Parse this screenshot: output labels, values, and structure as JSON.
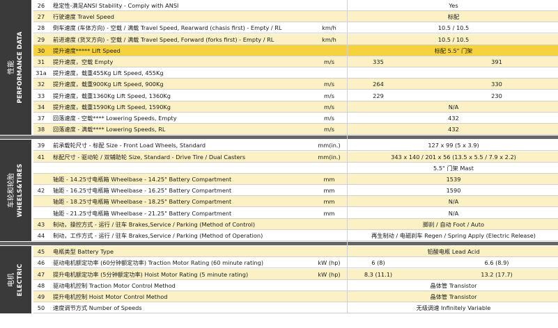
{
  "sections": {
    "performance": {
      "cn": "性能",
      "en": "PERFORMANCE DATA"
    },
    "wheels": {
      "cn": "车轮和轮胎",
      "en": "WHEELS&TIRES"
    },
    "electric": {
      "cn": "电机",
      "en": "ELECTRIC"
    }
  },
  "rows": [
    {
      "num": "26",
      "desc": "稳定性-满足ANSI    Stability - Comply with ANSI",
      "unit": "",
      "val": "Yes"
    },
    {
      "num": "27",
      "desc": "行驶速度    Travel Speed",
      "unit": "",
      "val": "标配"
    },
    {
      "num": "28",
      "desc": "倒车速度 (车体方向) - 空载 / 满载    Travel Speed, Rearward (chasis first) - Empty / RL",
      "unit": "km/h",
      "val": "10.5 / 10.5"
    },
    {
      "num": "29",
      "desc": "前进速度 (货叉方向) - 空载 / 满载    Travel Speed, Forward (forks first) - Empty / RL",
      "unit": "km/h",
      "val": "10.5 / 10.5"
    },
    {
      "num": "30",
      "desc": "提升速度*****    Lift Speed",
      "unit": "",
      "val": "标配   5.5\" 门架"
    },
    {
      "num": "31",
      "desc": "提升速度，空载    Empty",
      "unit": "m/s",
      "v1": "335",
      "v2": "391"
    },
    {
      "num": "31a",
      "desc": "提升速度，载重455Kg    Lift Speed, 455Kg",
      "unit": "",
      "val": ""
    },
    {
      "num": "32",
      "desc": "提升速度，载重900Kg    Lift Speed, 900Kg",
      "unit": "m/s",
      "v1": "264",
      "v2": "330"
    },
    {
      "num": "33",
      "desc": "提升速度，载重1360Kg    Lift Speed, 1360Kg",
      "unit": "m/s",
      "v1": "229",
      "v2": "230"
    },
    {
      "num": "34",
      "desc": "提升速度，载重1590Kg    Lift Speed, 1590Kg",
      "unit": "m/s",
      "val": "N/A"
    },
    {
      "num": "37",
      "desc": "回落速度 - 空载****    Lowering Speeds, Empty",
      "unit": "m/s",
      "val": "432"
    },
    {
      "num": "38",
      "desc": "回落速度 - 满载****    Lowering Speeds, RL",
      "unit": "m/s",
      "val": "432"
    },
    {
      "num": "39",
      "desc": "前承载轮尺寸 - 标配    Size - Front Load Wheels, Standard",
      "unit": "mm(in.)",
      "val": "127 x 99 (5 x 3.9)"
    },
    {
      "num": "41",
      "desc": "标配尺寸 - 驱动轮 / 双辅助轮    Size, Standard - Drive Tire / Dual Casters",
      "unit": "mm(in.)",
      "val": "343 x 140 / 201 x 56 (13.5 x 5.5 / 7.9 x 2.2)"
    },
    {
      "num": "",
      "desc": "",
      "unit": "",
      "val": "5.5\" 门架 Mast"
    },
    {
      "num": "",
      "desc": "轴距 - 14.25寸电瓶箱    Wheelbase - 14.25\" Battery Compartment",
      "unit": "mm",
      "val": "1539"
    },
    {
      "num": "",
      "desc": "轴距 - 16.25寸电瓶箱    Wheelbase - 16.25\" Battery Compartment",
      "unit": "mm",
      "val": "1590"
    },
    {
      "num": "",
      "desc": "轴距 - 18.25寸电瓶箱    Wheelbase - 18.25\" Battery Compartment",
      "unit": "mm",
      "val": "N/A"
    },
    {
      "num": "",
      "desc": "轴距 - 21.25寸电瓶箱    Wheelbase - 21.25\" Battery Compartment",
      "unit": "mm",
      "val": "N/A"
    },
    {
      "num": "43",
      "desc": "制动，操控方式 - 运行 / 驻车    Brakes,Service / Parking (Method of Control)",
      "unit": "",
      "val": "脚刹 / 自动 Foot / Auto"
    },
    {
      "num": "44",
      "desc": "制动，工作方式 - 运行 / 驻车    Brakes,Service / Parking (Method of Operation)",
      "unit": "",
      "val": "再生制动 / 电磁刹车 Regen / Spring Apply (Electric Release)"
    },
    {
      "num": "45",
      "desc": "电瓶类型    Battery Type",
      "unit": "",
      "val": "铅酸电瓶 Lead Acid"
    },
    {
      "num": "46",
      "desc": "驱动电机额定功率 (60分钟额定功率)    Traction Motor Rating (60 minute rating)",
      "unit": "kW (hp)",
      "v1": "6 (8)",
      "v2": "6.6 (8.9)"
    },
    {
      "num": "47",
      "desc": "提升电机额定功率 (5分钟额定功率)    Hoist Motor Rating (5 minute rating)",
      "unit": "kW (hp)",
      "v1": "8.3 (11.1)",
      "v2": "13.2 (17.7)"
    },
    {
      "num": "48",
      "desc": "驱动电机控制    Traction Motor Control Method",
      "unit": "",
      "val": "晶体管 Transistor"
    },
    {
      "num": "49",
      "desc": "提升电机控制    Hoist Motor Control Method",
      "unit": "",
      "val": "晶体管 Transistor"
    },
    {
      "num": "50",
      "desc": "速度调节方式    Number of Speeds",
      "unit": "",
      "val": "无级调速 Infinitely Variable"
    }
  ],
  "row42_num": "42"
}
